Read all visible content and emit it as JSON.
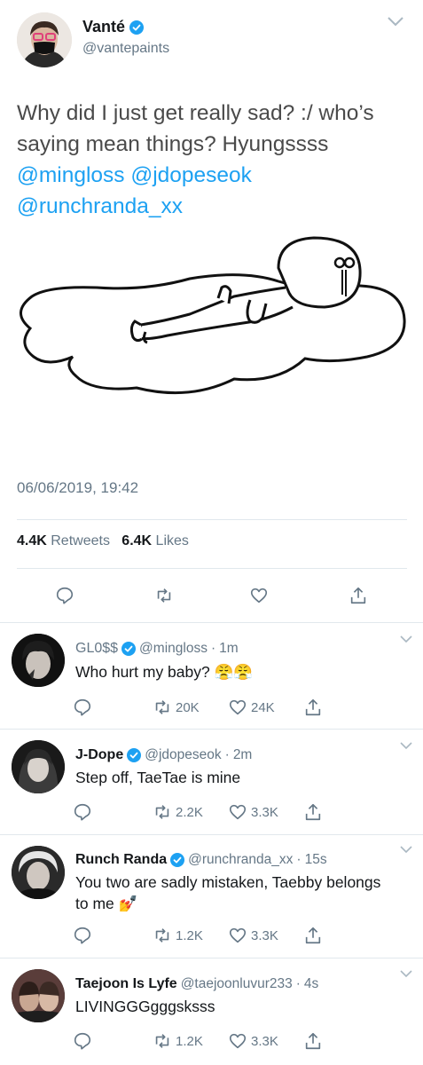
{
  "main_tweet": {
    "author_name": "Vanté",
    "author_handle": "@vantepaints",
    "text_plain": "Why did I just get really sad? :/ who’s saying mean things? Hyungssss",
    "mentions": [
      "@mingloss",
      "@jdopeseok",
      "@runchranda_xx"
    ],
    "timestamp": "06/06/2019, 19:42",
    "retweets_count": "4.4K",
    "retweets_label": "Retweets",
    "likes_count": "6.4K",
    "likes_label": "Likes"
  },
  "colors": {
    "accent": "#1da1f2",
    "secondary_text": "#657786",
    "divider": "#e1e8ed"
  },
  "replies": [
    {
      "name": "GL0$$",
      "handle": "@mingloss",
      "dot": "·",
      "time": "1m",
      "text": "Who hurt my baby? 😤😤",
      "retweets": "20K",
      "likes": "24K"
    },
    {
      "name": "J-Dope",
      "handle": "@jdopeseok",
      "dot": "·",
      "time": "2m",
      "text": "Step off, TaeTae is mine",
      "retweets": "2.2K",
      "likes": "3.3K"
    },
    {
      "name": "Runch Randa",
      "handle": "@runchranda_xx",
      "dot": "·",
      "time": "15s",
      "text": "You two are sadly mistaken, Taebby belongs to me 💅",
      "retweets": "1.2K",
      "likes": "3.3K"
    },
    {
      "name": "Taejoon Is Lyfe",
      "handle": "@taejoonluvur233",
      "dot": "·",
      "time": "4s",
      "text": "LIVINGGGgggsksss",
      "retweets": "1.2K",
      "likes": "3.3K"
    }
  ]
}
